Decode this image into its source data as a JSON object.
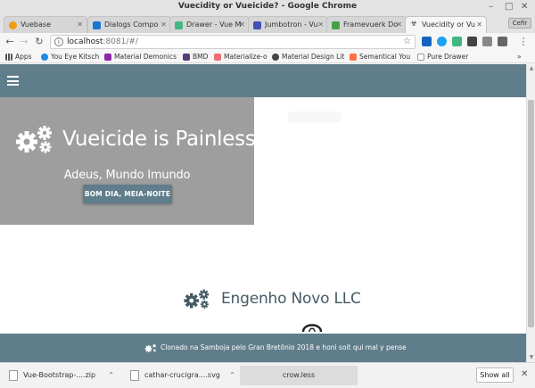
{
  "window": {
    "title": "Vuecidity or Vueicide? - Google Chrome",
    "profile_label": "Cefir"
  },
  "tabs": [
    {
      "label": "Vuebase",
      "icon": "vuebase-favicon",
      "color": "#f39c12"
    },
    {
      "label": "Dialogs Compo",
      "icon": "vuetify-favicon",
      "color": "#1976d2"
    },
    {
      "label": "Drawer - Vue M",
      "icon": "vuematerial-favicon",
      "color": "#41b883"
    },
    {
      "label": "Jumbotron - Vu",
      "icon": "jumbotron-favicon",
      "color": "#3f51b5"
    },
    {
      "label": "Framevuerk Do",
      "icon": "framevuerk-favicon",
      "color": "#43a047"
    },
    {
      "label": "Vuecidity or Vu",
      "icon": "biohazard-favicon",
      "color": "#333333"
    }
  ],
  "address": {
    "url_host": "localhost",
    "url_rest": ":8081/#/"
  },
  "bookmarks": [
    {
      "label": "Apps",
      "icon": "apps-grid-icon",
      "color": "#555555"
    },
    {
      "label": "You Eye Kitsch",
      "icon": "you-eye-kitsch-icon",
      "color": "#1e88e5"
    },
    {
      "label": "Material Demonics",
      "icon": "material-demonics-icon",
      "color": "#8e24aa"
    },
    {
      "label": "BMD",
      "icon": "bmd-icon",
      "color": "#563d7c"
    },
    {
      "label": "Materialize-o",
      "icon": "materialize-icon",
      "color": "#ee6e73"
    },
    {
      "label": "Material Design Lit",
      "icon": "material-design-lite-icon",
      "color": "#444444"
    },
    {
      "label": "Semantical You",
      "icon": "semantic-ui-icon",
      "color": "#ff7043"
    },
    {
      "label": "Pure Drawer",
      "icon": "pure-drawer-icon",
      "color": "#999999"
    }
  ],
  "page": {
    "jumbotron": {
      "title": "Vueicide is Painless",
      "subtitle": "Adeus, Mundo Imundo",
      "button_label": "BOM DIA, MEIA-NOITE"
    },
    "brand": {
      "name": "Engenho Novo LLC"
    },
    "footer": {
      "text": "Clonado na Samboja pelo Gran Bretônio 2018 e honi soit qui mal y pense"
    },
    "colors": {
      "appbar": "#607d8b",
      "jumbotron_bg": "#9e9e9e",
      "brand_text": "#455a64"
    }
  },
  "downloads": [
    {
      "name": "Vue-Bootstrap-....zip"
    },
    {
      "name": "cathar-crucigra....svg"
    },
    {
      "name": "crow.less"
    }
  ],
  "shelf": {
    "show_all_label": "Show all"
  }
}
